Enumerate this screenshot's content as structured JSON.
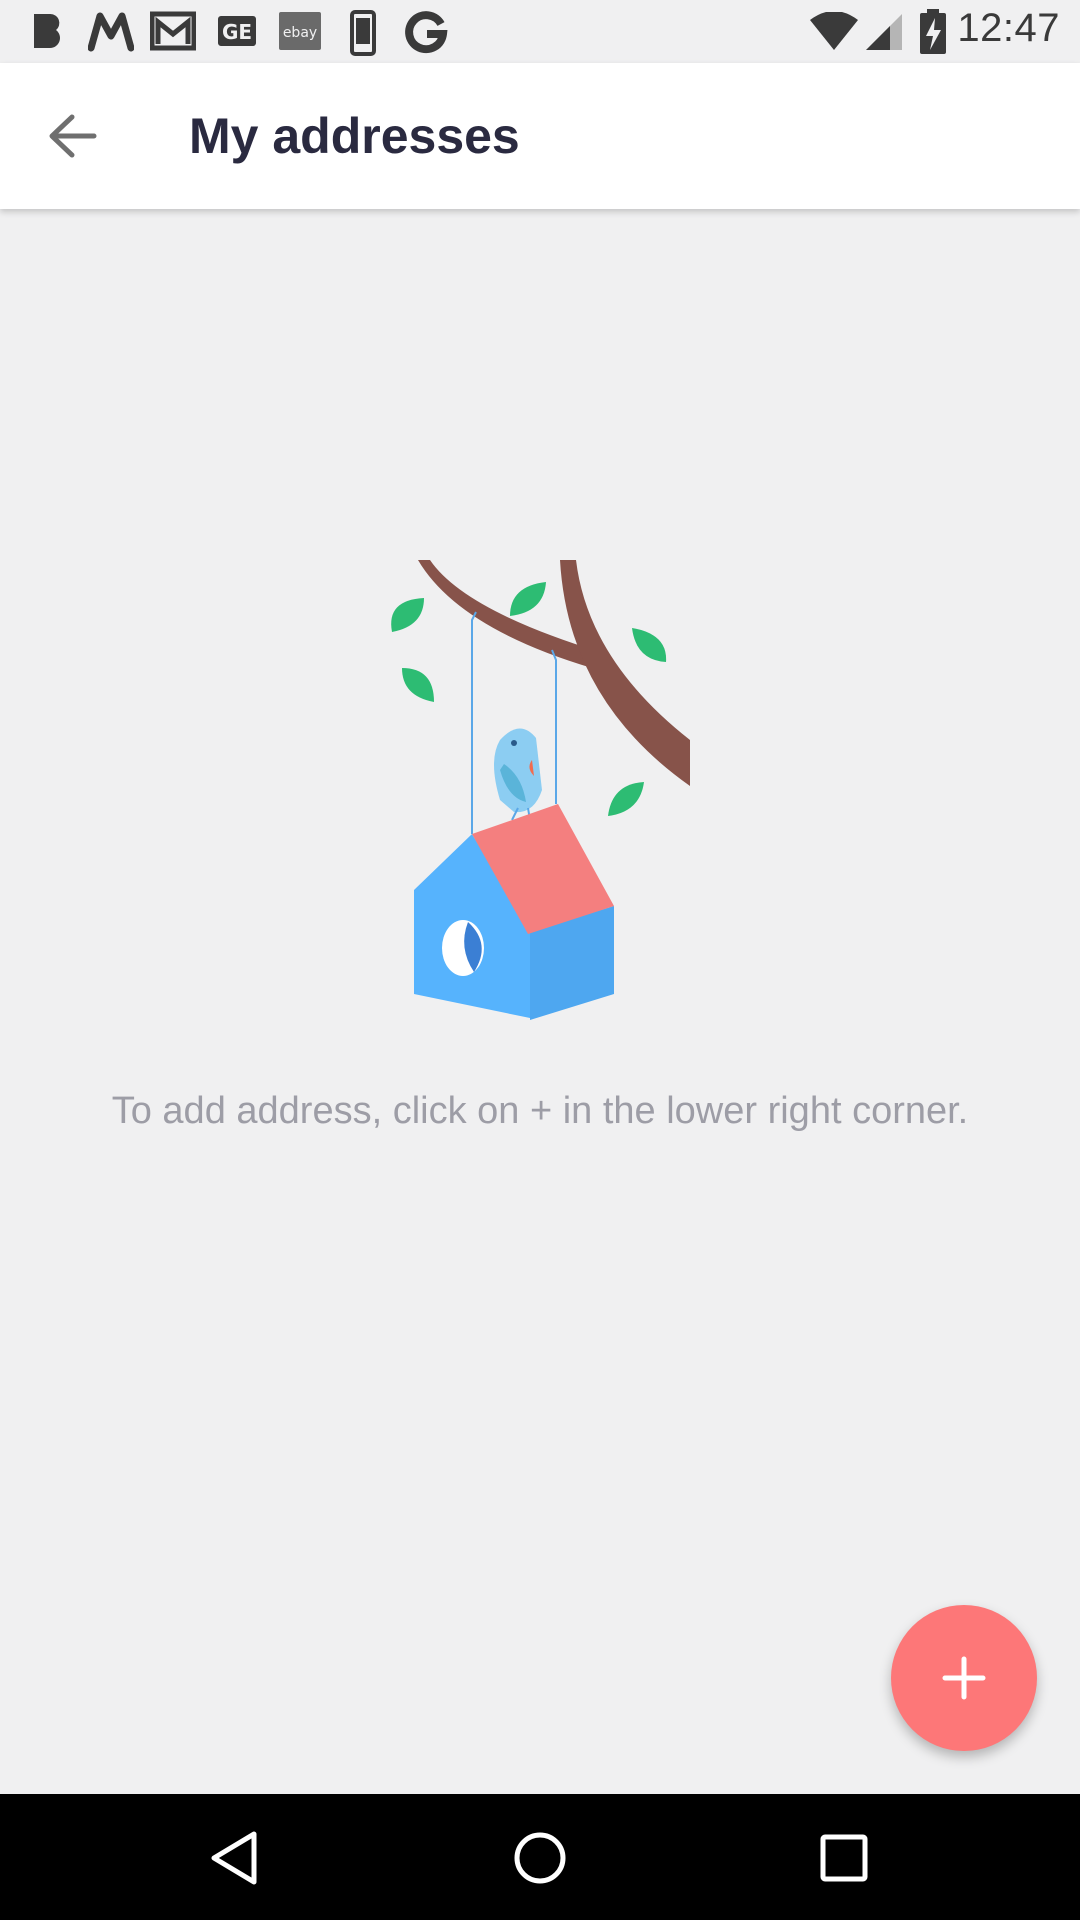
{
  "status_bar": {
    "time": "12:47",
    "notification_icons": [
      "b-icon",
      "m-icon",
      "gmail-icon",
      "ge-icon",
      "ebay-icon",
      "phone-icon",
      "google-icon"
    ],
    "ebay_text": "ebay",
    "ge_text": "GE",
    "status_icons": [
      "wifi-icon",
      "signal-icon",
      "battery-charging-icon"
    ]
  },
  "app_bar": {
    "title": "My addresses",
    "back_icon": "arrow-back-icon"
  },
  "empty_state": {
    "message": "To add address, click on + in the lower right corner.",
    "illustration": "birdhouse-illustration"
  },
  "fab": {
    "icon": "plus-icon",
    "color": "#fd7778"
  },
  "nav_bar": {
    "buttons": [
      "back-triangle-icon",
      "home-circle-icon",
      "recents-square-icon"
    ]
  },
  "colors": {
    "background": "#f0f0f1",
    "title": "#2a2a40",
    "text_muted": "#9d9da6",
    "accent": "#fd7778"
  }
}
